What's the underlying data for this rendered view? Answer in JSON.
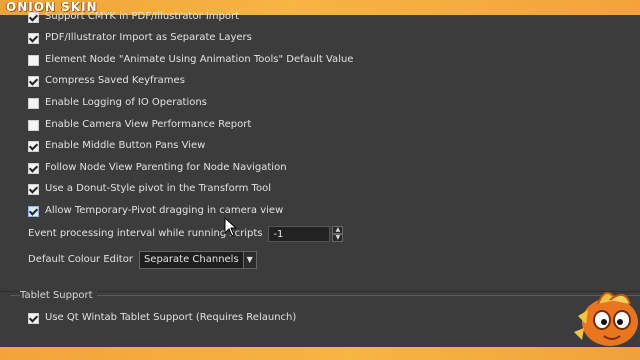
{
  "brand": "ONION SKIN",
  "options": [
    {
      "label": "Support CMYK in PDF/Illustrator Import",
      "checked": true
    },
    {
      "label": "PDF/Illustrator Import as Separate Layers",
      "checked": true
    },
    {
      "label": "Element Node \"Animate Using Animation Tools\" Default Value",
      "checked": false
    },
    {
      "label": "Compress Saved Keyframes",
      "checked": true
    },
    {
      "label": "Enable Logging of IO Operations",
      "checked": false
    },
    {
      "label": "Enable Camera View Performance Report",
      "checked": false
    },
    {
      "label": "Enable Middle Button Pans View",
      "checked": true
    },
    {
      "label": "Follow Node View Parenting for Node Navigation",
      "checked": true
    },
    {
      "label": "Use a Donut-Style pivot in the Transform Tool",
      "checked": true
    },
    {
      "label": "Allow Temporary-Pivot dragging in camera view",
      "checked": true
    }
  ],
  "event_interval": {
    "label": "Event processing interval while running scripts",
    "value": "-1"
  },
  "colour_editor": {
    "label": "Default Colour Editor",
    "value": "Separate Channels"
  },
  "tablet": {
    "title": "Tablet Support",
    "option": {
      "label": "Use Qt Wintab Tablet Support (Requires Relaunch)",
      "checked": true
    }
  }
}
